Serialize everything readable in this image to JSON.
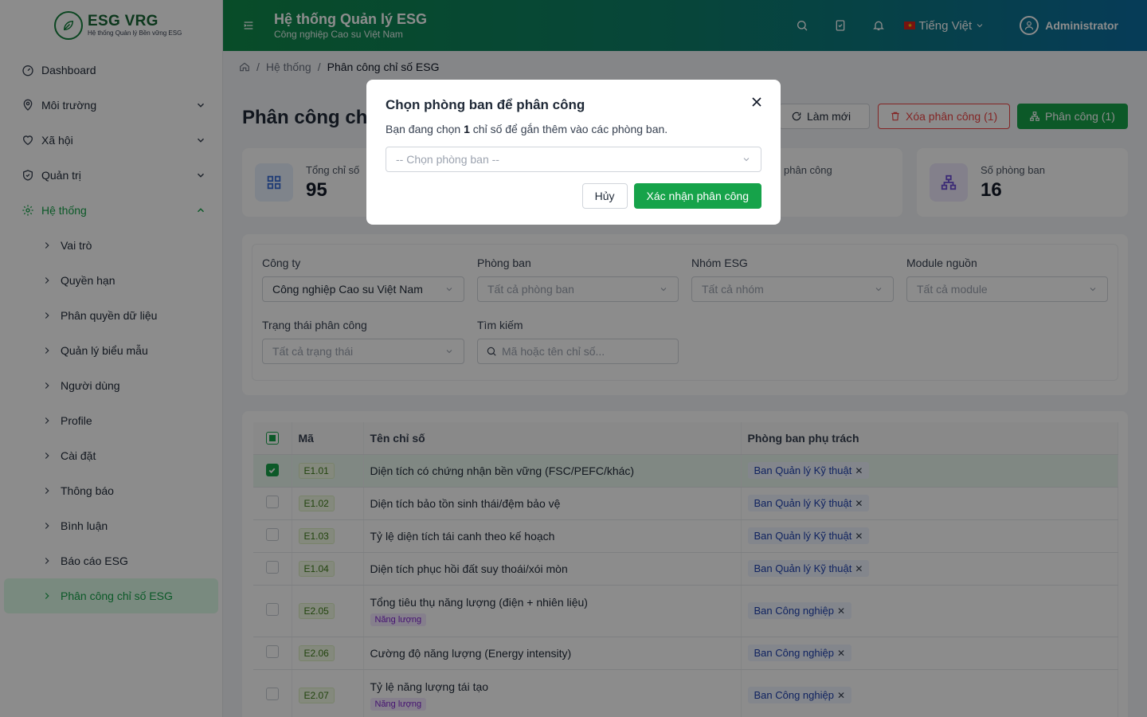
{
  "logo": {
    "title": "ESG VRG",
    "subtitle": "Hệ thống Quản lý Bền vững ESG"
  },
  "header": {
    "title": "Hệ thống Quản lý ESG",
    "subtitle": "Công nghiệp Cao su Việt Nam",
    "language": "Tiếng Việt",
    "user": "Administrator"
  },
  "sidebar": {
    "items": [
      {
        "label": "Dashboard",
        "icon": "dashboard-icon"
      },
      {
        "label": "Môi trường",
        "icon": "location-icon"
      },
      {
        "label": "Xã hội",
        "icon": "heart-icon"
      },
      {
        "label": "Quản trị",
        "icon": "shield-icon"
      },
      {
        "label": "Hệ thống",
        "icon": "gear-icon"
      }
    ],
    "subitems": [
      "Vai trò",
      "Quyền hạn",
      "Phân quyền dữ liệu",
      "Quản lý biểu mẫu",
      "Người dùng",
      "Profile",
      "Cài đặt",
      "Thông báo",
      "Bình luận",
      "Báo cáo ESG",
      "Phân công chỉ số ESG"
    ]
  },
  "breadcrumb": {
    "parent": "Hệ thống",
    "current": "Phân công chỉ số ESG"
  },
  "page": {
    "title": "Phân công chỉ"
  },
  "toolbar": {
    "refresh": "Làm mới",
    "delete": "Xóa phân công (1)",
    "assign": "Phân công (1)"
  },
  "stats": [
    {
      "label": "Tổng chỉ số",
      "value": "95"
    },
    {
      "label": "phân công",
      "value": ""
    },
    {
      "label": "Số phòng ban",
      "value": "16"
    }
  ],
  "filters": {
    "company_label": "Công ty",
    "company_value": "Công nghiệp Cao su Việt Nam",
    "dept_label": "Phòng ban",
    "dept_placeholder": "Tất cả phòng ban",
    "group_label": "Nhóm ESG",
    "group_placeholder": "Tất cả nhóm",
    "module_label": "Module nguồn",
    "module_placeholder": "Tất cả module",
    "status_label": "Trạng thái phân công",
    "status_placeholder": "Tất cả trạng thái",
    "search_label": "Tìm kiếm",
    "search_placeholder": "Mã hoặc tên chỉ số..."
  },
  "table": {
    "columns": [
      "Mã",
      "Tên chỉ số",
      "Phòng ban phụ trách"
    ],
    "rows": [
      {
        "code": "E1.01",
        "name": "Diện tích có chứng nhận bền vững (FSC/PEFC/khác)",
        "subtag": "",
        "dept": "Ban Quản lý Kỹ thuật",
        "checked": true
      },
      {
        "code": "E1.02",
        "name": "Diện tích bảo tồn sinh thái/đệm bảo vệ",
        "subtag": "",
        "dept": "Ban Quản lý Kỹ thuật",
        "checked": false
      },
      {
        "code": "E1.03",
        "name": "Tỷ lệ diện tích tái canh theo kế hoạch",
        "subtag": "",
        "dept": "Ban Quản lý Kỹ thuật",
        "checked": false
      },
      {
        "code": "E1.04",
        "name": "Diện tích phục hồi đất suy thoái/xói mòn",
        "subtag": "",
        "dept": "Ban Quản lý Kỹ thuật",
        "checked": false
      },
      {
        "code": "E2.05",
        "name": "Tổng tiêu thụ năng lượng (điện + nhiên liệu)",
        "subtag": "Năng lượng",
        "dept": "Ban Công nghiệp",
        "checked": false
      },
      {
        "code": "E2.06",
        "name": "Cường độ năng lượng (Energy intensity)",
        "subtag": "",
        "dept": "Ban Công nghiệp",
        "checked": false
      },
      {
        "code": "E2.07",
        "name": "Tỷ lệ năng lượng tái tạo",
        "subtag": "Năng lượng",
        "dept": "Ban Công nghiệp",
        "checked": false
      }
    ]
  },
  "modal": {
    "title": "Chọn phòng ban để phân công",
    "desc_before": "Bạn đang chọn ",
    "count": "1",
    "desc_after": " chỉ số để gắn thêm vào các phòng ban.",
    "select_placeholder": "-- Chọn phòng ban --",
    "cancel": "Hủy",
    "confirm": "Xác nhận phân công"
  },
  "colors": {
    "primary": "#16a34a",
    "danger": "#ef4444",
    "header_start": "#0f8a4a",
    "header_end": "#0b6da0"
  }
}
